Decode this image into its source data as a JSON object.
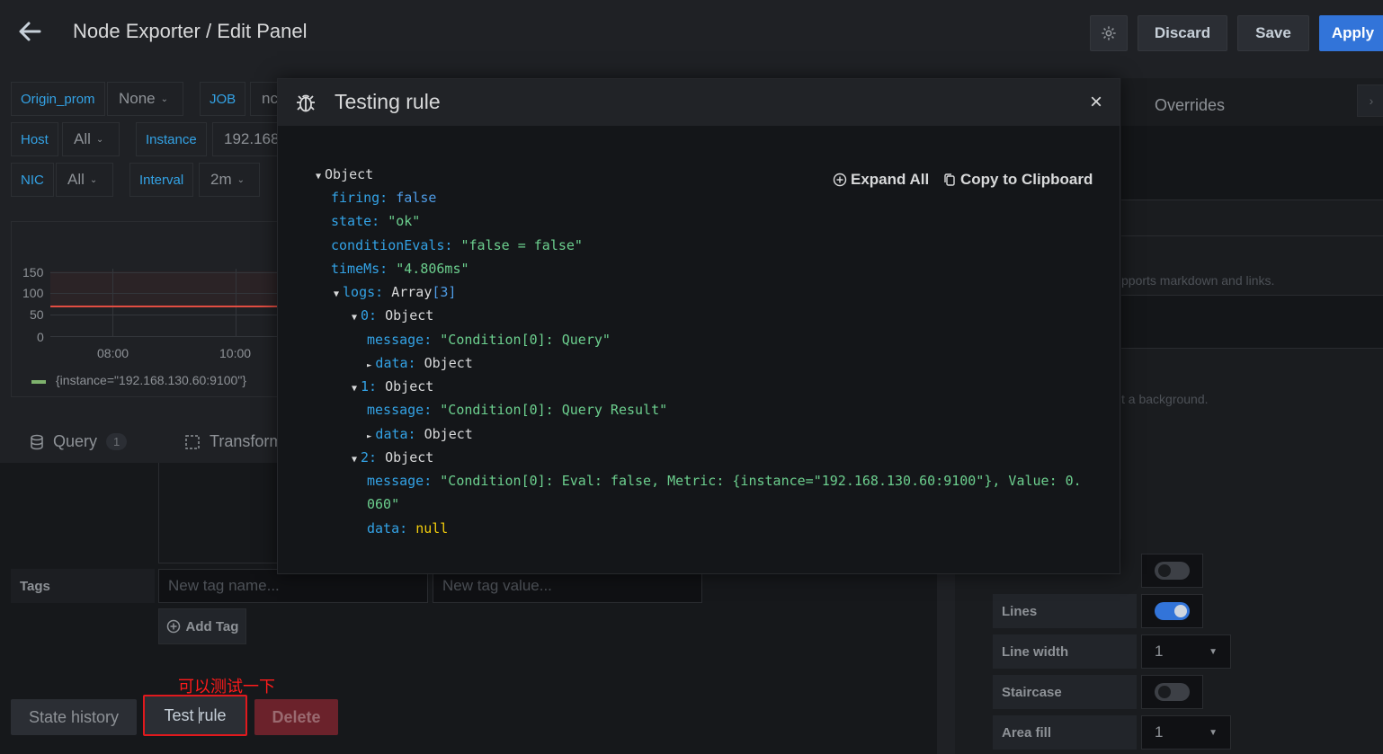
{
  "header": {
    "title": "Node Exporter / Edit Panel",
    "discard_label": "Discard",
    "save_label": "Save",
    "apply_label": "Apply"
  },
  "variables": {
    "row1": [
      {
        "label": "Origin_prom",
        "value": "None"
      },
      {
        "label": "JOB",
        "value": "nc"
      }
    ],
    "row2": [
      {
        "label": "Host",
        "value": "All"
      },
      {
        "label": "Instance",
        "value": "192.168"
      }
    ],
    "row3": [
      {
        "label": "NIC",
        "value": "All"
      },
      {
        "label": "Interval",
        "value": "2m"
      }
    ]
  },
  "graph": {
    "yticks": [
      "150",
      "100",
      "50",
      "0"
    ],
    "xticks": [
      "08:00",
      "10:00"
    ],
    "legend": "{instance=\"192.168.130.60:9100\"}",
    "colors": {
      "threshold_band": "#5a2a2e",
      "series_line": "#e24d42",
      "legend_swatch": "#7eb26d"
    }
  },
  "query_tabs": {
    "query_label": "Query",
    "query_count": "1",
    "transform_label": "Transform"
  },
  "tags": {
    "label": "Tags",
    "name_placeholder": "New tag name...",
    "value_placeholder": "New tag value...",
    "add_label": "Add Tag"
  },
  "annotation": "可以测试一下",
  "footer_buttons": {
    "state_history": "State history",
    "test_rule_prefix": "Test ",
    "test_rule_suffix": "rule",
    "delete": "Delete"
  },
  "right_panel": {
    "overrides_label": "Overrides",
    "markdown_hint": "pports markdown and links.",
    "background_hint": "t a background.",
    "options": [
      {
        "label": "",
        "type": "toggle",
        "on": false
      },
      {
        "label": "Lines",
        "type": "toggle",
        "on": true
      },
      {
        "label": "Line width",
        "type": "select",
        "value": "1"
      },
      {
        "label": "Staircase",
        "type": "toggle",
        "on": false
      },
      {
        "label": "Area fill",
        "type": "select",
        "value": "1"
      }
    ]
  },
  "modal": {
    "title": "Testing rule",
    "close": "×",
    "expand_all": "Expand All",
    "copy_clipboard": "Copy to Clipboard",
    "json": {
      "root": "Object",
      "firing_key": "firing:",
      "firing_val": "false",
      "state_key": "state:",
      "state_val": "\"ok\"",
      "cond_key": "conditionEvals:",
      "cond_val": "\"false = false\"",
      "time_key": "timeMs:",
      "time_val": "\"4.806ms\"",
      "logs_key": "logs:",
      "logs_type": "Array",
      "logs_count": "[3]",
      "log0_key": "0:",
      "log0_type": "Object",
      "log0_msg_key": "message:",
      "log0_msg": "\"Condition[0]: Query\"",
      "log0_data_key": "data:",
      "log0_data": "Object",
      "log1_key": "1:",
      "log1_type": "Object",
      "log1_msg_key": "message:",
      "log1_msg": "\"Condition[0]: Query Result\"",
      "log1_data_key": "data:",
      "log1_data": "Object",
      "log2_key": "2:",
      "log2_type": "Object",
      "log2_msg_key": "message:",
      "log2_msg_a": "\"Condition[0]: Eval: false, Metric: {instance=\"192.168.130.60:9100\"}, Value: 0.",
      "log2_msg_b": "060\"",
      "log2_data_key": "data:",
      "log2_data": "null"
    }
  }
}
